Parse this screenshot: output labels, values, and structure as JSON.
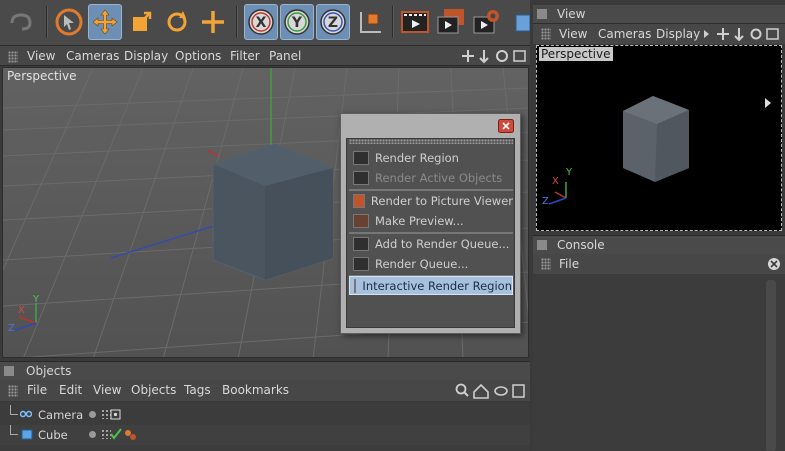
{
  "viewport": {
    "menu": [
      "View",
      "Cameras",
      "Display",
      "Options",
      "Filter",
      "Panel"
    ],
    "label": "Perspective"
  },
  "right_panel": {
    "title": "View",
    "menu": [
      "View",
      "Cameras",
      "Display"
    ],
    "label": "Perspective"
  },
  "console": {
    "title": "Console",
    "menu": [
      "File"
    ]
  },
  "objects": {
    "title": "Objects",
    "menu": [
      "File",
      "Edit",
      "View",
      "Objects",
      "Tags",
      "Bookmarks"
    ],
    "rows": [
      {
        "name": "Camera"
      },
      {
        "name": "Cube"
      }
    ]
  },
  "popup": {
    "items": [
      {
        "label": "Render Region",
        "enabled": true
      },
      {
        "label": "Render Active Objects",
        "enabled": false
      },
      {
        "label": "Render to Picture Viewer",
        "enabled": true
      },
      {
        "label": "Make Preview...",
        "enabled": true
      },
      {
        "label": "Add to Render Queue...",
        "enabled": true
      },
      {
        "label": "Render Queue...",
        "enabled": true
      },
      {
        "label": "Interactive Render Region",
        "enabled": true,
        "highlighted": true
      }
    ]
  },
  "axis_labels": {
    "x": "X",
    "y": "Y",
    "z": "Z"
  },
  "colors": {
    "accent": "#6d8fb4",
    "highlight": "#a7c0de"
  }
}
